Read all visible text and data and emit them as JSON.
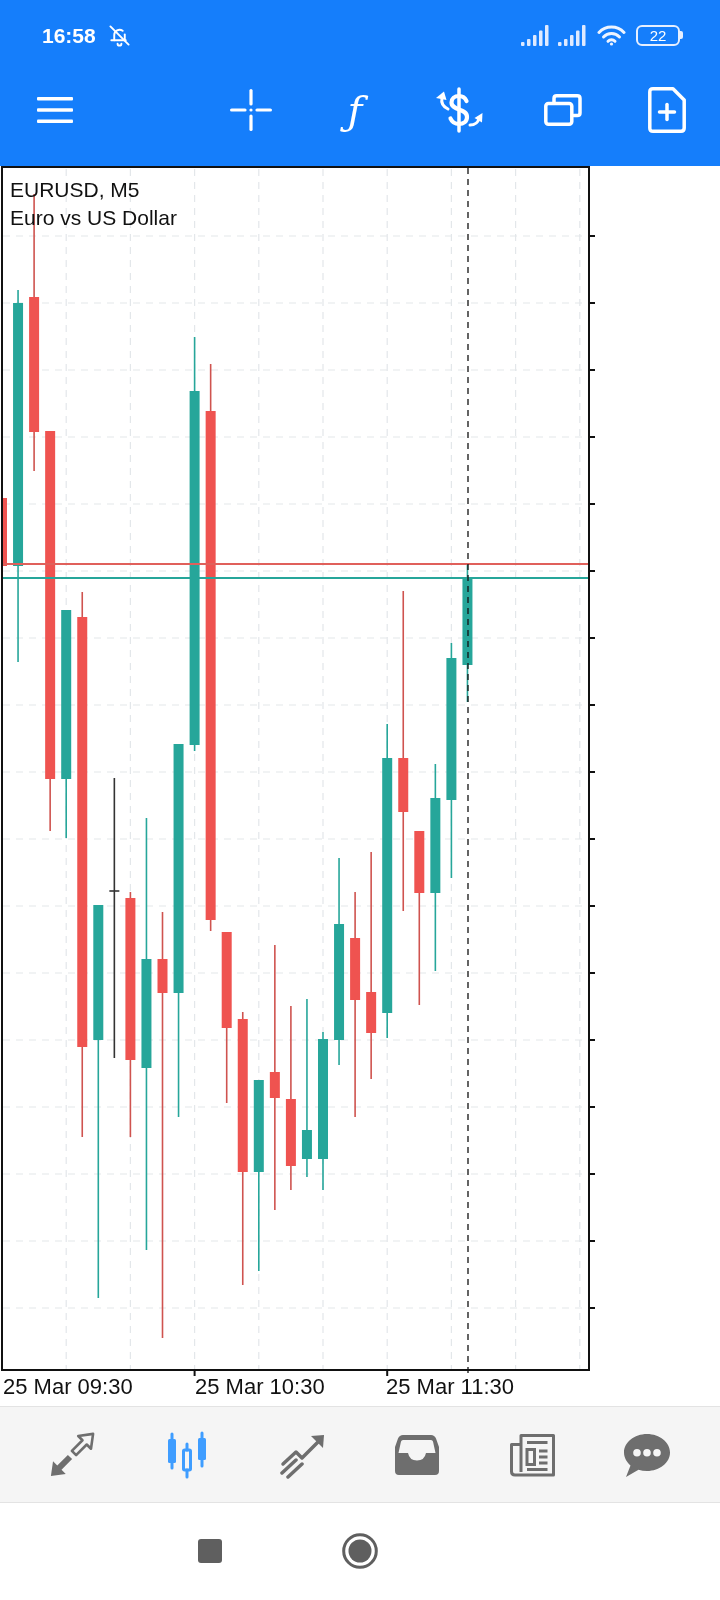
{
  "status_bar": {
    "time": "16:58",
    "battery": "22"
  },
  "toolbar": {
    "function_symbol": "ƒ"
  },
  "chart": {
    "title": "EURUSD, M5",
    "description": "Euro vs US Dollar",
    "time_labels": [
      "25 Mar 09:30",
      "25 Mar 10:30",
      "25 Mar 11:30"
    ]
  },
  "bottom_nav": {
    "tabs": [
      {
        "kind": "arrows",
        "selected": false
      },
      {
        "kind": "candles",
        "selected": true
      },
      {
        "kind": "trend",
        "selected": false
      },
      {
        "kind": "tray",
        "selected": false
      },
      {
        "kind": "newspaper",
        "selected": false
      },
      {
        "kind": "chat",
        "selected": false
      }
    ]
  }
}
